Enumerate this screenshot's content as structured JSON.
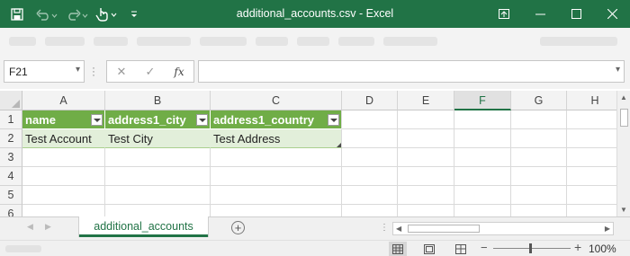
{
  "window": {
    "title": "additional_accounts.csv  -  Excel",
    "accent": "#217346"
  },
  "formula_bar": {
    "name_box": "F21",
    "fx_label": "fx",
    "formula": ""
  },
  "grid": {
    "columns": [
      "A",
      "B",
      "C",
      "D",
      "E",
      "F",
      "G",
      "H"
    ],
    "selected_column": "F",
    "rows": [
      "1",
      "2",
      "3",
      "4",
      "5",
      "6"
    ],
    "header_row": [
      "name",
      "address1_city",
      "address1_country"
    ],
    "data_rows": [
      [
        "Test Account",
        "Test City",
        "Test Address"
      ]
    ],
    "table_header_color": "#70ad47",
    "table_band_color": "#e2efda"
  },
  "sheets": {
    "tabs": [
      "additional_accounts"
    ],
    "active": "additional_accounts"
  },
  "status_bar": {
    "zoom": "100%"
  },
  "icons": [
    "save-icon",
    "undo-icon",
    "redo-icon",
    "touch-mode-icon",
    "customize-qat-icon",
    "ribbon-display-icon",
    "minimize-icon",
    "maximize-icon",
    "close-icon",
    "cancel-icon",
    "enter-icon",
    "function-icon",
    "normal-view-icon",
    "page-layout-icon",
    "page-break-icon"
  ]
}
